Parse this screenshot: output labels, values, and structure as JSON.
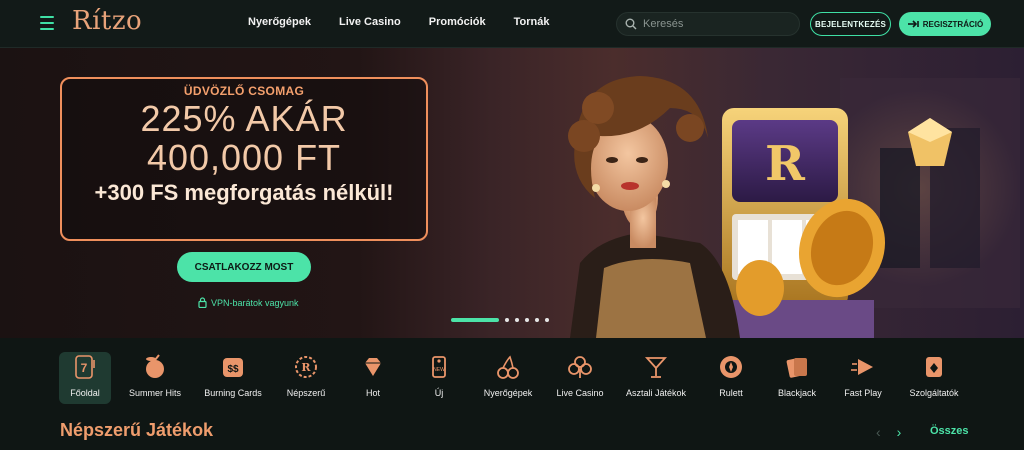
{
  "brand": {
    "logo": "Rítzo",
    "accent": "#4ce3a8",
    "promo_color": "#ef8f5c"
  },
  "nav": {
    "items": [
      "Nyerőgépek",
      "Live Casino",
      "Promóciók",
      "Tornák"
    ]
  },
  "search": {
    "placeholder": "Keresés"
  },
  "auth": {
    "login": "BEJELENTKEZÉS",
    "register": "REGISZTRÁCIÓ"
  },
  "hero": {
    "kicker": "ÜDVÖZLŐ CSOMAG",
    "line1": "225% AKÁR",
    "line2": "400,000 FT",
    "line3": "+300 FS megforgatás nélkül!",
    "cta": "CSATLAKOZZ MOST",
    "vpn": "VPN-barátok vagyunk",
    "slides": 6,
    "active_slide": 1
  },
  "categories": [
    {
      "label": "Főoldal",
      "icon": "slot-seven-icon",
      "selected": true
    },
    {
      "label": "Summer Hits",
      "icon": "fruit-cocktail-icon"
    },
    {
      "label": "Burning Cards",
      "icon": "dollar-card-icon"
    },
    {
      "label": "Népszerű",
      "icon": "r-medal-icon"
    },
    {
      "label": "Hot",
      "icon": "diamond-icon"
    },
    {
      "label": "Új",
      "icon": "new-tag-icon"
    },
    {
      "label": "Nyerőgépek",
      "icon": "cherries-icon"
    },
    {
      "label": "Live Casino",
      "icon": "club-icon"
    },
    {
      "label": "Asztali Játékok",
      "icon": "cocktail-glass-icon"
    },
    {
      "label": "Rulett",
      "icon": "roulette-icon"
    },
    {
      "label": "Blackjack",
      "icon": "cards-icon"
    },
    {
      "label": "Fast Play",
      "icon": "fast-play-icon"
    },
    {
      "label": "Szolgáltatók",
      "icon": "provider-card-icon"
    }
  ],
  "section": {
    "title": "Népszerű Játékok",
    "all": "Összes"
  }
}
